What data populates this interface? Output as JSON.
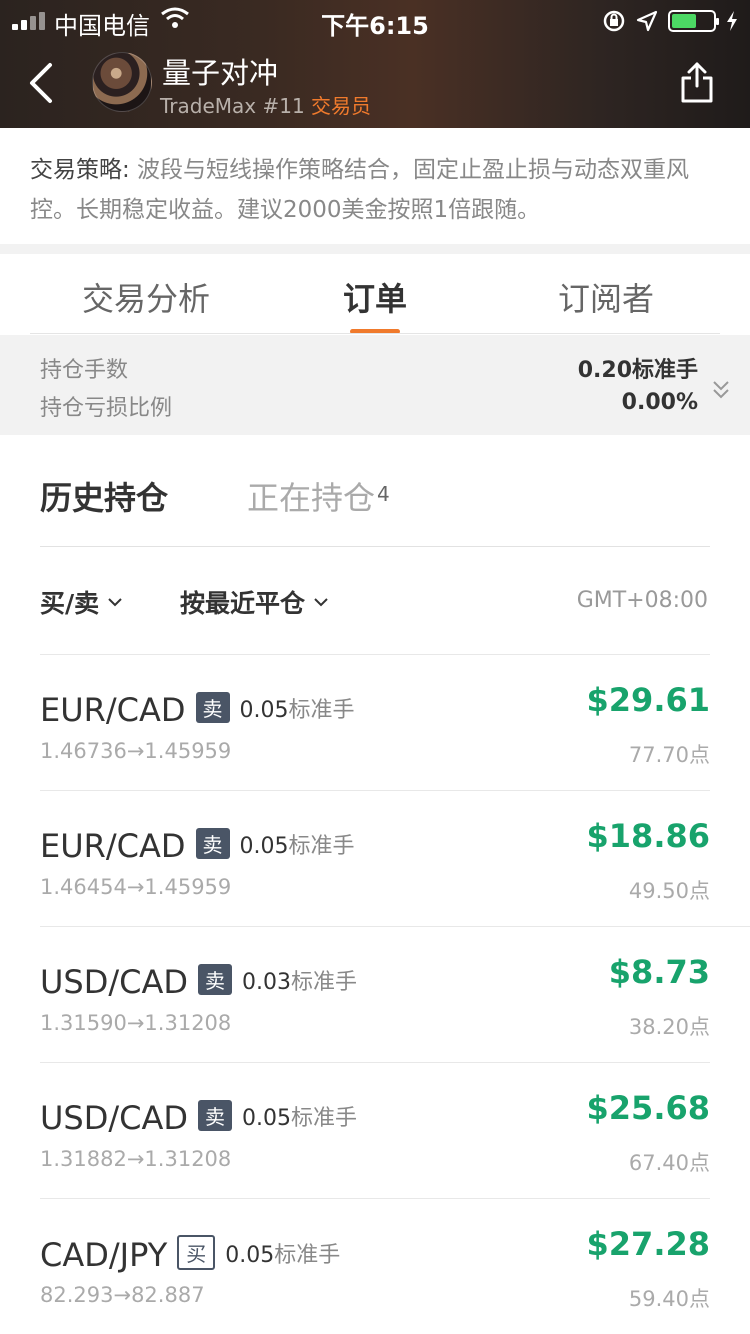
{
  "status_bar": {
    "carrier": "中国电信",
    "time": "下午6:15"
  },
  "header": {
    "trader_name": "量子对冲",
    "trader_tag": "TradeMax #11",
    "trader_role": "交易员"
  },
  "strategy": {
    "label": "交易策略:",
    "text": " 波段与短线操作策略结合，固定止盈止损与动态双重风控。长期稳定收益。建议2000美金按照1倍跟随。"
  },
  "tabs": [
    {
      "label": "交易分析"
    },
    {
      "label": "订单"
    },
    {
      "label": "订阅者"
    }
  ],
  "summary": {
    "lots_label": "持仓手数",
    "lots_value": "0.20标准手",
    "pl_label": "持仓亏损比例",
    "pl_value": "0.00%"
  },
  "subtabs": {
    "history": "历史持仓",
    "open": "正在持仓",
    "open_count": "4"
  },
  "filters": {
    "side": "买/卖",
    "sort": "按最近平仓",
    "timezone": "GMT+08:00"
  },
  "orders": [
    {
      "symbol": "EUR/CAD",
      "side": "卖",
      "side_type": "sell",
      "lots": "0.05",
      "lots_unit": "标准手",
      "prices": "1.46736→1.45959",
      "profit": "$29.61",
      "points": "77.70点"
    },
    {
      "symbol": "EUR/CAD",
      "side": "卖",
      "side_type": "sell",
      "lots": "0.05",
      "lots_unit": "标准手",
      "prices": "1.46454→1.45959",
      "profit": "$18.86",
      "points": "49.50点"
    },
    {
      "symbol": "USD/CAD",
      "side": "卖",
      "side_type": "sell",
      "lots": "0.03",
      "lots_unit": "标准手",
      "prices": "1.31590→1.31208",
      "profit": "$8.73",
      "points": "38.20点"
    },
    {
      "symbol": "USD/CAD",
      "side": "卖",
      "side_type": "sell",
      "lots": "0.05",
      "lots_unit": "标准手",
      "prices": "1.31882→1.31208",
      "profit": "$25.68",
      "points": "67.40点"
    },
    {
      "symbol": "CAD/JPY",
      "side": "买",
      "side_type": "buy",
      "lots": "0.05",
      "lots_unit": "标准手",
      "prices": "82.293→82.887",
      "profit": "$27.28",
      "points": "59.40点"
    }
  ],
  "colors": {
    "accent": "#f07a2c",
    "profit": "#18a36c",
    "badge": "#4a5566"
  }
}
